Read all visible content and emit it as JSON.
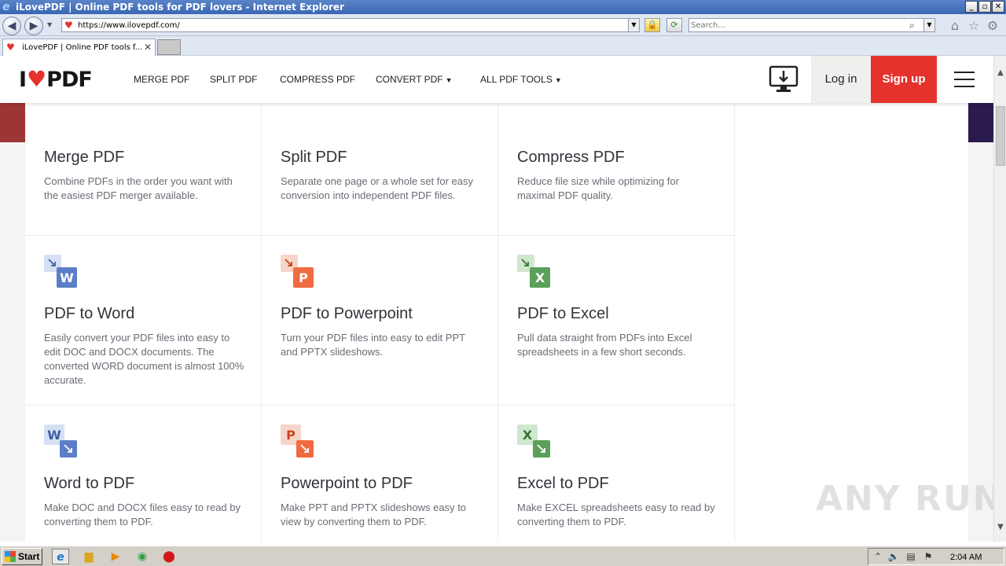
{
  "window": {
    "title": "iLovePDF | Online PDF tools for PDF lovers - Internet Explorer",
    "controls": {
      "minimize": "_",
      "maximize": "▫",
      "close": "✕"
    }
  },
  "address_bar": {
    "url": "https://www.ilovepdf.com/",
    "search_placeholder": "Search..."
  },
  "tabs": [
    {
      "label": "iLovePDF | Online PDF tools f...",
      "close": "✕"
    }
  ],
  "site": {
    "logo": {
      "left": "I",
      "right": "PDF"
    },
    "nav": [
      "MERGE PDF",
      "SPLIT PDF",
      "COMPRESS PDF",
      "CONVERT PDF",
      "ALL PDF TOOLS"
    ],
    "login": "Log in",
    "signup": "Sign up"
  },
  "colors": {
    "brand_red": "#e5322d",
    "merge_icon": "#e8694c",
    "compress_icon": "#8bc34a",
    "word_icon": "#5b7ec7",
    "powerpoint_icon": "#f06b42",
    "excel_icon": "#5a9f5a"
  },
  "tools": [
    {
      "title": "Merge PDF",
      "description": "Combine PDFs in the order you want with the easiest PDF merger available.",
      "icon": "merge-icon"
    },
    {
      "title": "Split PDF",
      "description": "Separate one page or a whole set for easy conversion into independent PDF files.",
      "icon": "split-icon"
    },
    {
      "title": "Compress PDF",
      "description": "Reduce file size while optimizing for maximal PDF quality.",
      "icon": "compress-icon"
    },
    {
      "title": "PDF to Word",
      "description": "Easily convert your PDF files into easy to edit DOC and DOCX documents. The converted WORD document is almost 100% accurate.",
      "icon": "pdf-to-word-icon",
      "letter": "W"
    },
    {
      "title": "PDF to Powerpoint",
      "description": "Turn your PDF files into easy to edit PPT and PPTX slideshows.",
      "icon": "pdf-to-powerpoint-icon",
      "letter": "P"
    },
    {
      "title": "PDF to Excel",
      "description": "Pull data straight from PDFs into Excel spreadsheets in a few short seconds.",
      "icon": "pdf-to-excel-icon",
      "letter": "X"
    },
    {
      "title": "Word to PDF",
      "description": "Make DOC and DOCX files easy to read by converting them to PDF.",
      "icon": "word-to-pdf-icon",
      "letter": "W"
    },
    {
      "title": "Powerpoint to PDF",
      "description": "Make PPT and PPTX slideshows easy to view by converting them to PDF.",
      "icon": "powerpoint-to-pdf-icon",
      "letter": "P"
    },
    {
      "title": "Excel to PDF",
      "description": "Make EXCEL spreadsheets easy to read by converting them to PDF.",
      "icon": "excel-to-pdf-icon",
      "letter": "X"
    }
  ],
  "watermark": "ANY RUN",
  "taskbar": {
    "start": "Start",
    "clock": "2:04 AM"
  }
}
